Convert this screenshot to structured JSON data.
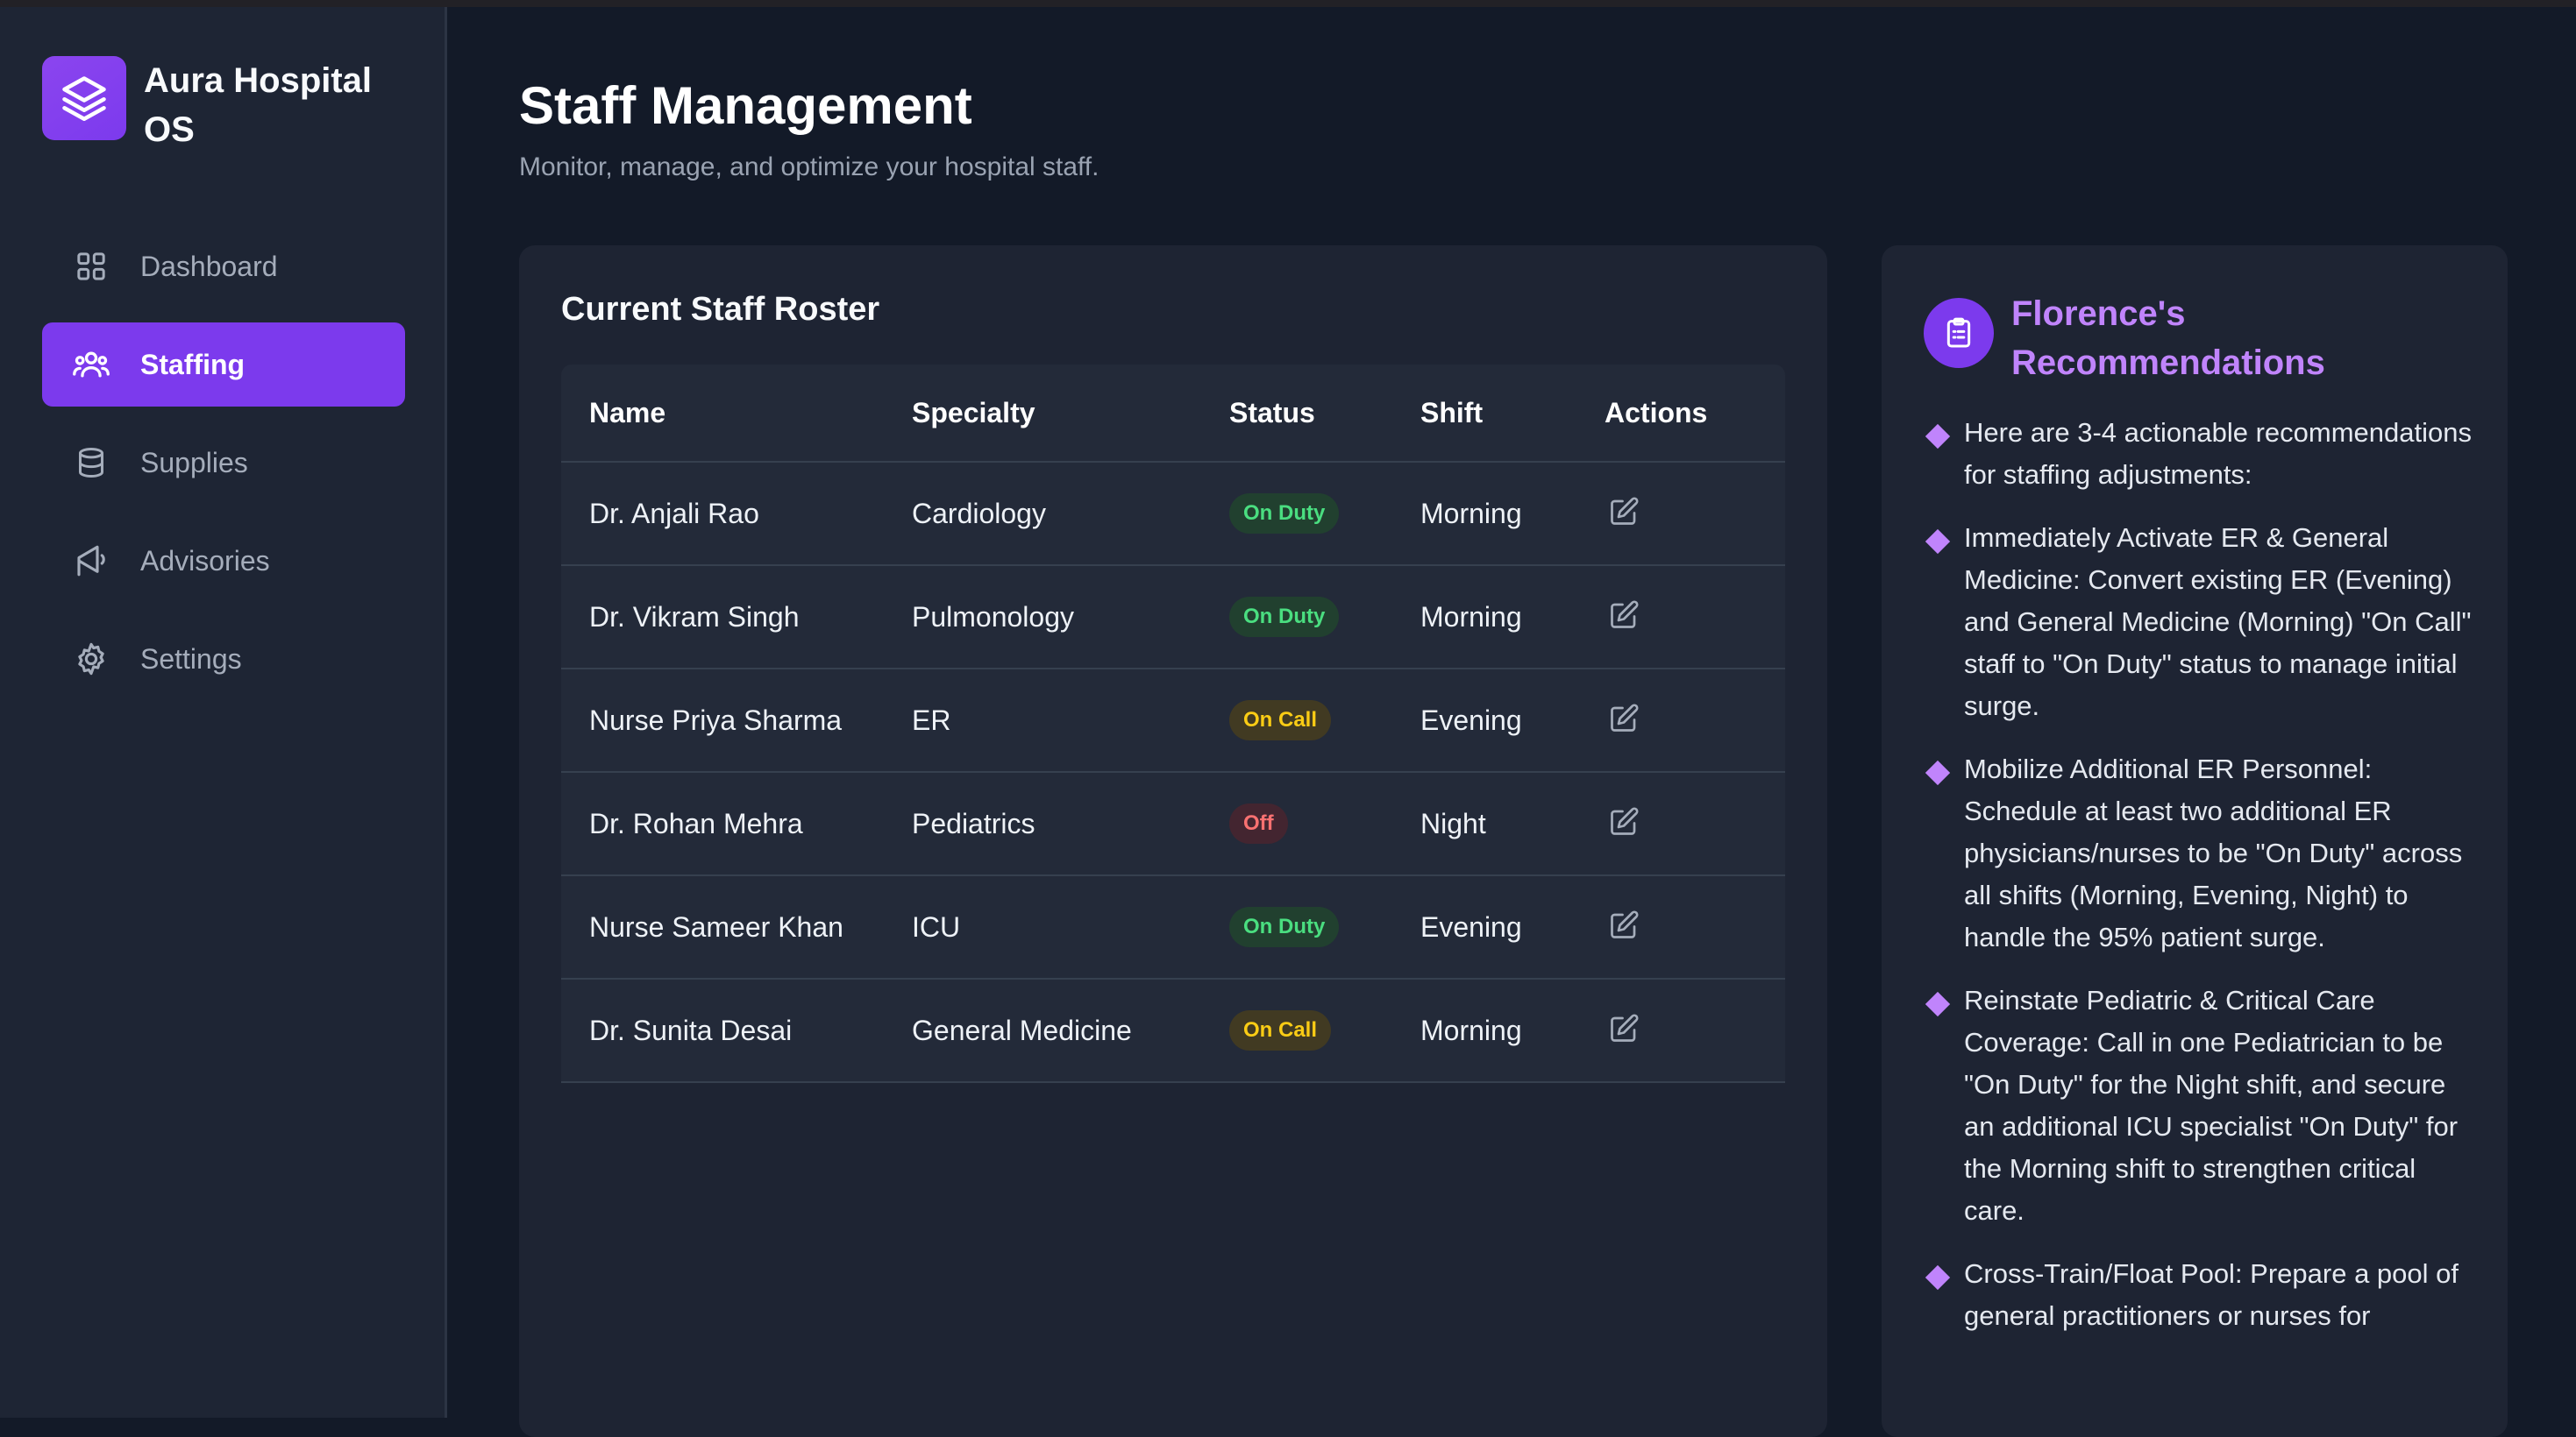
{
  "app": {
    "name": "Aura Hospital OS"
  },
  "sidebar": {
    "items": [
      {
        "label": "Dashboard",
        "icon": "grid-icon"
      },
      {
        "label": "Staffing",
        "icon": "users-icon",
        "active": true
      },
      {
        "label": "Supplies",
        "icon": "database-icon"
      },
      {
        "label": "Advisories",
        "icon": "megaphone-icon"
      },
      {
        "label": "Settings",
        "icon": "gear-icon"
      }
    ]
  },
  "header": {
    "title": "Staff Management",
    "subtitle": "Monitor, manage, and optimize your hospital staff."
  },
  "roster": {
    "title": "Current Staff Roster",
    "columns": [
      "Name",
      "Specialty",
      "Status",
      "Shift",
      "Actions"
    ],
    "rows": [
      {
        "name": "Dr. Anjali Rao",
        "specialty": "Cardiology",
        "status": "On Duty",
        "shift": "Morning"
      },
      {
        "name": "Dr. Vikram Singh",
        "specialty": "Pulmonology",
        "status": "On Duty",
        "shift": "Morning"
      },
      {
        "name": "Nurse Priya Sharma",
        "specialty": "ER",
        "status": "On Call",
        "shift": "Evening"
      },
      {
        "name": "Dr. Rohan Mehra",
        "specialty": "Pediatrics",
        "status": "Off",
        "shift": "Night"
      },
      {
        "name": "Nurse Sameer Khan",
        "specialty": "ICU",
        "status": "On Duty",
        "shift": "Evening"
      },
      {
        "name": "Dr. Sunita Desai",
        "specialty": "General Medicine",
        "status": "On Call",
        "shift": "Morning"
      }
    ]
  },
  "status_colors": {
    "On Duty": {
      "bg": "#21402f",
      "fg": "#4ade80"
    },
    "On Call": {
      "bg": "#413a22",
      "fg": "#facc15"
    },
    "Off": {
      "bg": "#432530",
      "fg": "#f87171"
    }
  },
  "recommendations": {
    "title": "Florence's Recommendations",
    "items": [
      "Here are 3-4 actionable recommendations for staffing adjustments:",
      "Immediately Activate ER & General Medicine: Convert existing ER (Evening) and General Medicine (Morning) \"On Call\" staff to \"On Duty\" status to manage initial surge.",
      "Mobilize Additional ER Personnel: Schedule at least two additional ER physicians/nurses to be \"On Duty\" across all shifts (Morning, Evening, Night) to handle the 95% patient surge.",
      "Reinstate Pediatric & Critical Care Coverage: Call in one Pediatrician to be \"On Duty\" for the Night shift, and secure an additional ICU specialist \"On Duty\" for the Morning shift to strengthen critical care.",
      "Cross-Train/Float Pool: Prepare a pool of general practitioners or nurses for"
    ]
  },
  "colors": {
    "accent": "#7c3aed",
    "accent_light": "#c084fc",
    "background": "#131a28",
    "panel": "#1e2433"
  }
}
